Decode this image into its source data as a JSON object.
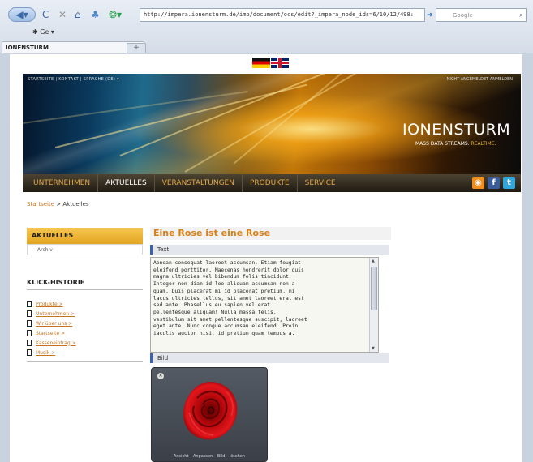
{
  "browser": {
    "url": "http://impera.ionensturm.de/imp/document/ocs/edit?_impera_node_ids=6/10/12/498:",
    "search_placeholder": "Google",
    "go_label": "Ge",
    "tab_title": "IONENSTURM",
    "new_tab": "+"
  },
  "header": {
    "top_links": "STARTSEITE  |  KONTAKT  |  SPRACHE (DE)",
    "login_text": "NICHT ANGEMELDET ANMELDEN",
    "logo": "IONENSTURM",
    "tagline_main": "MASS DATA STREAMS.",
    "tagline_accent": "REALTIME."
  },
  "mainnav": {
    "items": [
      "UNTERNEHMEN",
      "AKTUELLES",
      "VERANSTALTUNGEN",
      "PRODUKTE",
      "SERVICE"
    ],
    "active": "AKTUELLES"
  },
  "breadcrumb": {
    "home": "Startseite",
    "separator": " > ",
    "current": "Aktuelles"
  },
  "sidebar": {
    "aktuelles_title": "AKTUELLES",
    "archiv_label": "Archiv",
    "klick_title": "KLICK-HISTORIE",
    "history": [
      "Produkte >",
      "Unternehmen >",
      "Wir über uns >",
      "Startseite >",
      "Kasseneintrag >",
      "Musik >"
    ]
  },
  "content": {
    "title": "Eine Rose ist eine Rose",
    "text_label": "Text",
    "bild_label": "Bild",
    "body_lines": [
      "Aenean consequat laoreet accumsan. Etiam feugiat",
      "eleifend porttitor. Maecenas hendrerit dolor quis",
      "magna ultricies vel bibendum felis tincidunt.",
      "Integer non diam id leo aliquam accumsan non a",
      "quam. Duis placerat mi id placerat pretium, mi",
      "lacus ultricies tellus, sit amet laoreet erat est",
      "sed ante. Phasellus eu sapien vel erat",
      "pellentesque aliquam! Nulla massa felis,",
      "vestibulum sit amet pellentesque suscipit, laoreet",
      "eget ante. Nunc congue accumsan eleifend. Proin",
      "iaculis auctor nisi, id pretium quam tempus a."
    ],
    "image_menu": "Ansicht  Anpassen  Bild löschen"
  },
  "colors": {
    "accent_orange": "#d97f17",
    "nav_gold": "#e0a84a",
    "section_blue": "#3b60b5"
  },
  "icons": [
    "back-icon",
    "reload-icon",
    "stop-icon",
    "home-icon",
    "bookmark-icon",
    "rss-icon",
    "facebook-icon",
    "twitter-icon",
    "close-icon",
    "rose-image"
  ]
}
